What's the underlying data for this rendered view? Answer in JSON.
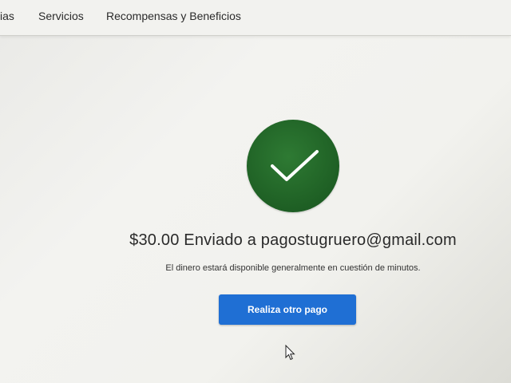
{
  "nav": {
    "items": [
      "ias",
      "Servicios",
      "Recompensas y Beneficios"
    ]
  },
  "status": {
    "icon": "check-icon",
    "color": "#1e5f24"
  },
  "confirmation": {
    "message": "$30.00 Enviado a pagostugruero@gmail.com",
    "subtext": "El dinero estará disponible generalmente en cuestión de minutos."
  },
  "actions": {
    "another_payment_label": "Realiza otro pago",
    "button_color": "#1f6fd4"
  }
}
